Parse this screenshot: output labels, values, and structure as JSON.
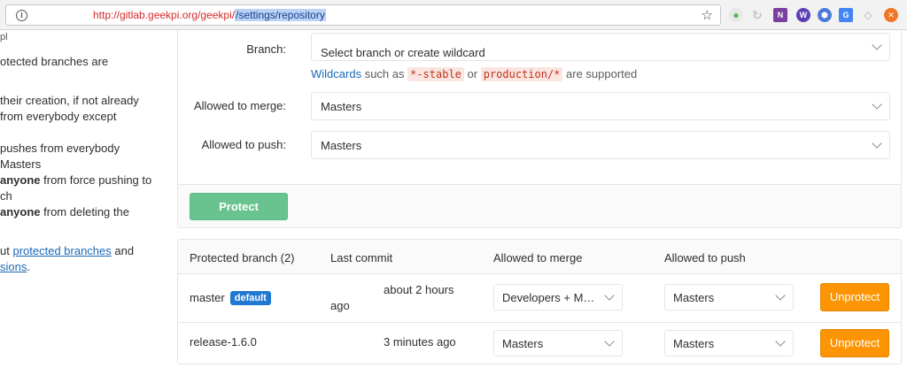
{
  "browser": {
    "url_base": "http://gitlab.geekpi.org/geekpi/",
    "url_selected": "/settings/repository",
    "bookmark_icon": "star-icon",
    "extensions": [
      {
        "name": "green-dot-extension-icon",
        "color": "#5cb85c",
        "glyph": "●"
      },
      {
        "name": "refresh-extension-icon",
        "color": "#cfcfcf",
        "glyph": "↻"
      },
      {
        "name": "onenote-extension-icon",
        "color": "#7b3fa0",
        "glyph": "N"
      },
      {
        "name": "wappalyzer-extension-icon",
        "color": "#5b3fb8",
        "glyph": "W"
      },
      {
        "name": "shield-extension-icon",
        "color": "#4a7bd9",
        "glyph": "⬢"
      },
      {
        "name": "translate-extension-icon",
        "color": "#4285f4",
        "glyph": "G"
      },
      {
        "name": "adblock-extension-icon",
        "color": "#bbbbbb",
        "glyph": "◇"
      },
      {
        "name": "close-extension-icon",
        "color": "#f07626",
        "glyph": "✕"
      }
    ]
  },
  "left_text": {
    "line0": "pl",
    "line1": "otected branches are",
    "line2": "their creation, if not already",
    "line3": "from everybody except",
    "line4": "pushes from everybody",
    "line5": "Masters",
    "line6_bold": "anyone",
    "line6_rest": " from force pushing to",
    "line7": "ch",
    "line8_bold": "anyone",
    "line8_rest": " from deleting the",
    "line9_pre": "ut ",
    "line9_link": "protected branches",
    "line9_post": " and",
    "line10_link": "sions",
    "line10_post": "."
  },
  "form": {
    "branch_label": "Branch:",
    "branch_placeholder": "Select branch or create wildcard",
    "hint_link": "Wildcards",
    "hint_mid1": " such as ",
    "hint_code1": "*-stable",
    "hint_mid2": " or ",
    "hint_code2": "production/*",
    "hint_end": " are supported",
    "merge_label": "Allowed to merge:",
    "merge_value": "Masters",
    "push_label": "Allowed to push:",
    "push_value": "Masters",
    "protect_button": "Protect"
  },
  "table": {
    "headers": {
      "branch": "Protected branch (2)",
      "commit": "Last commit",
      "merge": "Allowed to merge",
      "push": "Allowed to push"
    },
    "rows": [
      {
        "branch": "master",
        "badge": "default",
        "commit_line1": "about 2 hours",
        "commit_line2": "ago",
        "merge": "Developers + Masters",
        "push": "Masters",
        "action": "Unprotect"
      },
      {
        "branch": "release-1.6.0",
        "commit_line1": "3 minutes ago",
        "merge": "Masters",
        "push": "Masters",
        "action": "Unprotect"
      }
    ]
  },
  "colors": {
    "protect_green": "#69c38e",
    "unprotect_orange": "#fc9403",
    "link_blue": "#1b69b6",
    "badge_blue": "#1f78d1"
  }
}
